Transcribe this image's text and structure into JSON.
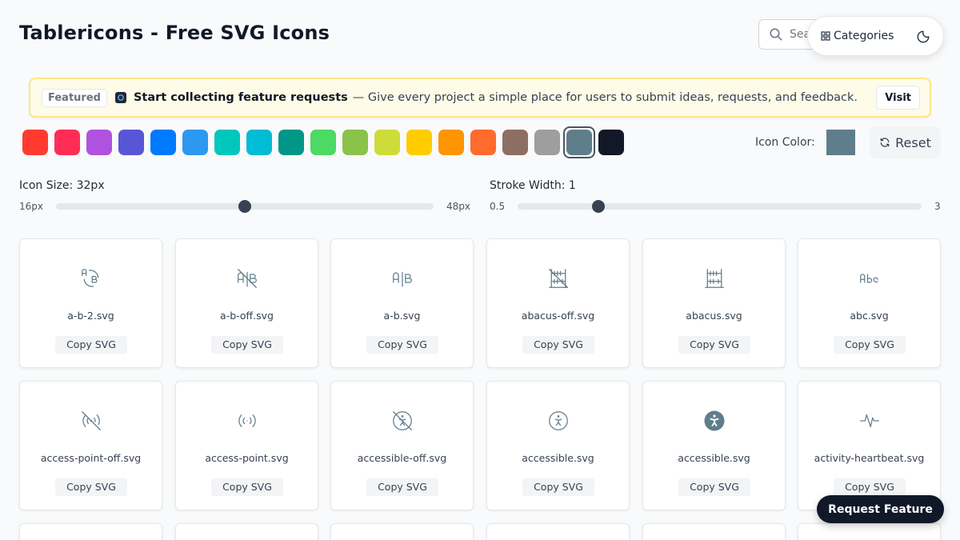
{
  "header": {
    "title": "Tablericons - Free SVG Icons",
    "search_placeholder": "Search icons...",
    "categories_label": "Categories"
  },
  "banner": {
    "tag": "Featured",
    "headline": "Start collecting feature requests",
    "description": "— Give every project a simple place for users to submit ideas, requests, and feedback.",
    "visit_label": "Visit"
  },
  "palette": {
    "colors": [
      "#ff3b30",
      "#ff2d55",
      "#af52de",
      "#5856d6",
      "#007aff",
      "#2c98f0",
      "#00c7be",
      "#00bcd4",
      "#009688",
      "#4cd964",
      "#8bc34a",
      "#cddc39",
      "#ffcc00",
      "#ff9500",
      "#ff6b2c",
      "#8d6e63",
      "#9e9e9e",
      "#607d8b",
      "#111827"
    ],
    "selected_index": 17,
    "icon_color_label": "Icon Color:",
    "icon_color_value": "#607d8b",
    "reset_label": "Reset"
  },
  "size_slider": {
    "label": "Icon Size: 32px",
    "min_label": "16px",
    "max_label": "48px",
    "min": 16,
    "max": 48,
    "value": 32
  },
  "stroke_slider": {
    "label": "Stroke Width: 1",
    "min_label": "0.5",
    "max_label": "3",
    "min": 0.5,
    "max": 3,
    "value": 1
  },
  "icons": [
    {
      "name": "a-b-2.svg",
      "icon": "a-b-2-icon",
      "copy": "Copy SVG"
    },
    {
      "name": "a-b-off.svg",
      "icon": "a-b-off-icon",
      "copy": "Copy SVG"
    },
    {
      "name": "a-b.svg",
      "icon": "a-b-icon",
      "copy": "Copy SVG"
    },
    {
      "name": "abacus-off.svg",
      "icon": "abacus-off-icon",
      "copy": "Copy SVG"
    },
    {
      "name": "abacus.svg",
      "icon": "abacus-icon",
      "copy": "Copy SVG"
    },
    {
      "name": "abc.svg",
      "icon": "abc-icon",
      "copy": "Copy SVG"
    },
    {
      "name": "access-point-off.svg",
      "icon": "access-point-off-icon",
      "copy": "Copy SVG"
    },
    {
      "name": "access-point.svg",
      "icon": "access-point-icon",
      "copy": "Copy SVG"
    },
    {
      "name": "accessible-off.svg",
      "icon": "accessible-off-icon",
      "copy": "Copy SVG"
    },
    {
      "name": "accessible.svg",
      "icon": "accessible-icon",
      "copy": "Copy SVG"
    },
    {
      "name": "accessible.svg",
      "icon": "accessible-filled-icon",
      "copy": "Copy SVG"
    },
    {
      "name": "activity-heartbeat.svg",
      "icon": "activity-heartbeat-icon",
      "copy": "Copy SVG"
    }
  ],
  "request_feature_label": "Request Feature"
}
